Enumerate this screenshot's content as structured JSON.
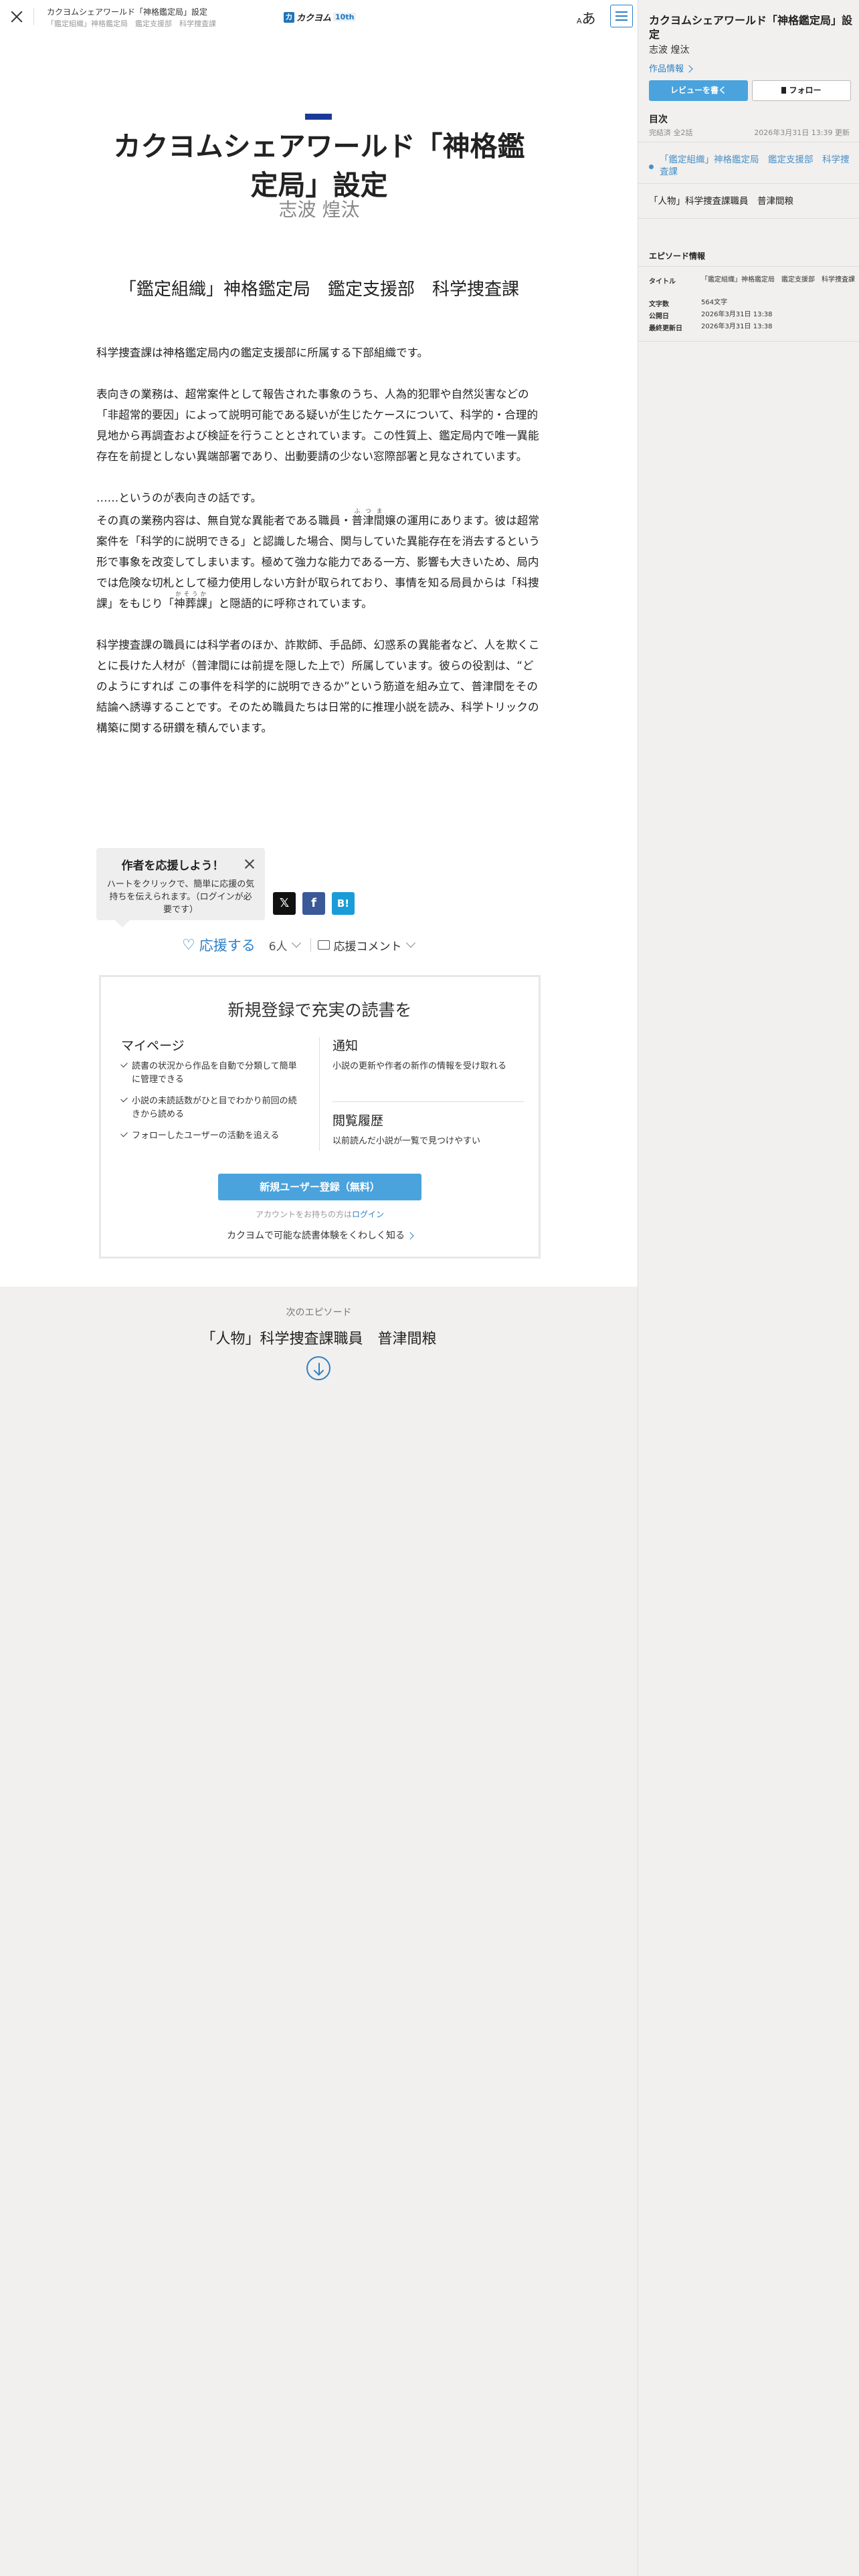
{
  "header": {
    "work_title": "カクヨムシェアワールド「神格鑑定局」設定",
    "episode_title": "「鑑定組織」神格鑑定局　鑑定支援部　科学捜査課",
    "logo_text": "カクヨム",
    "logo_badge": "10th",
    "font_button": "あ",
    "font_button_small": "A"
  },
  "main": {
    "work_title": "カクヨムシェアワールド「神格鑑定局」設定",
    "author": "志波 煌汰",
    "episode_title": "「鑑定組織」神格鑑定局　鑑定支援部　科学捜査課",
    "paragraphs": {
      "p1": "科学捜査課は神格鑑定局内の鑑定支援部に所属する下部組織です。",
      "p2": "表向きの業務は、超常案件として報告された事象のうち、人為的犯罪や自然災害などの「非超常的要因」によって説明可能である疑いが生じたケースについて、科学的・合理的見地から再調査および検証を行うこととされています。この性質上、鑑定局内で唯一異能存在を前提としない異端部署であり、出動要請の少ない窓際部署と見なされています。",
      "p3": "……というのが表向きの話です。",
      "p4a": "その真の業務内容は、無自覚な異能者である職員・",
      "p4_ruby_base": "普津間",
      "p4_ruby_text": "ふつま",
      "p4b": "嬢の運用にあります。彼は超常案件を「科学的に説明できる」と認識した場合、関与していた異能存在を消去するという形で事象を改変してしまいます。極めて強力な能力である一方、影響も大きいため、局内では危険な切札として極力使用しない方針が取られており、事情を知る局員からは「科捜課」をもじり「",
      "p4_ruby2_base": "神葬課",
      "p4_ruby2_text": "かそうか",
      "p4c": "」と隠語的に呼称されています。",
      "p5": "科学捜査課の職員には科学者のほか、詐欺師、手品師、幻惑系の異能者など、人を欺くことに長けた人材が（普津間には前提を隠した上で）所属しています。彼らの役割は、“どのようにすれば この事件を科学的に説明できるか”という筋道を組み立て、普津間をその結論へ誘導することです。そのため職員たちは日常的に推理小説を読み、科学トリックの構築に関する研鑽を積んでいます。"
    }
  },
  "cheer_tip": {
    "title": "作者を応援しよう！",
    "text": "ハートをクリックで、簡単に応援の気持ちを伝えられます。（ログインが必要です）"
  },
  "share": {
    "x": "𝕏",
    "facebook": "f",
    "hatena": "B!"
  },
  "cheer": {
    "label": "応援する",
    "count": "6人",
    "comment_label": "応援コメント"
  },
  "register": {
    "title": "新規登録で充実の読書を",
    "mypage_title": "マイページ",
    "mypage_items": [
      "読書の状況から作品を自動で分類して簡単に管理できる",
      "小説の未読話数がひと目でわかり前回の続きから読める",
      "フォローしたユーザーの活動を追える"
    ],
    "notice_title": "通知",
    "notice_text": "小説の更新や作者の新作の情報を受け取れる",
    "history_title": "閲覧履歴",
    "history_text": "以前読んだ小説が一覧で見つけやすい",
    "button": "新規ユーザー登録（無料）",
    "login_prefix": "アカウントをお持ちの方は",
    "login_link": "ログイン",
    "more": "カクヨムで可能な読書体験をくわしく知る"
  },
  "next": {
    "label": "次のエピソード",
    "title": "「人物」科学捜査課職員　普津間粮"
  },
  "sidebar": {
    "title": "カクヨムシェアワールド「神格鑑定局」設定",
    "author": "志波 煌汰",
    "work_info": "作品情報",
    "review_button": "レビューを書く",
    "follow_button": "フォロー",
    "toc_title": "目次",
    "status": "完結済 全2話",
    "updated": "2026年3月31日 13:39 更新",
    "episodes": [
      "「鑑定組織」神格鑑定局　鑑定支援部　科学捜査課",
      "「人物」科学捜査課職員　普津間粮"
    ],
    "episode_info_title": "エピソード情報",
    "meta": {
      "title_label": "タイトル",
      "title_value": "「鑑定組織」神格鑑定局　鑑定支援部　科学捜査課",
      "chars_label": "文字数",
      "chars_value": "564文字",
      "published_label": "公開日",
      "published_value": "2026年3月31日 13:38",
      "updated_label": "最終更新日",
      "updated_value": "2026年3月31日 13:38"
    }
  },
  "colors": {
    "accent": "#2c7fc7",
    "button": "#4aa3dd",
    "chapter_bar": "#1a3a9a"
  }
}
